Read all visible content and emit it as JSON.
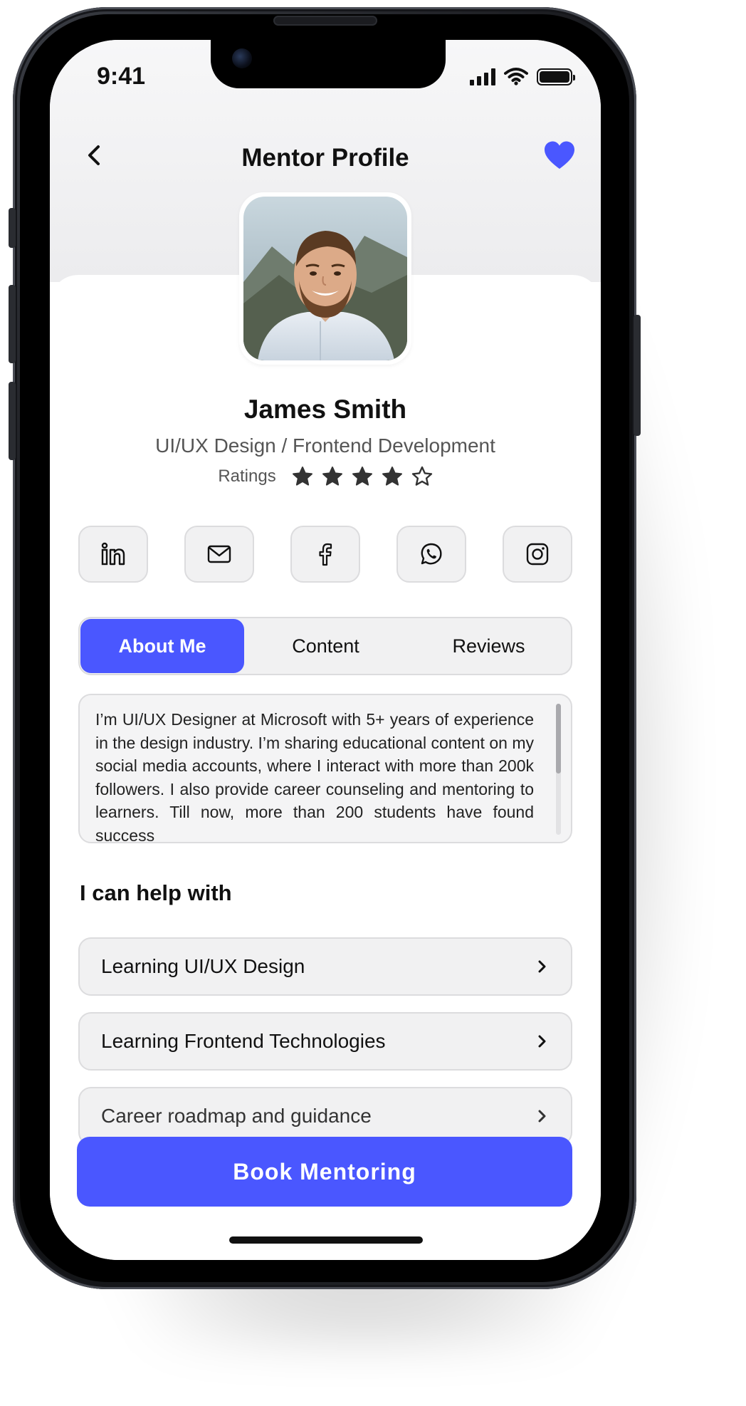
{
  "status_bar": {
    "time": "9:41"
  },
  "nav": {
    "title": "Mentor Profile"
  },
  "profile": {
    "name": "James Smith",
    "subtitle": "UI/UX Design / Frontend Development",
    "ratings_label": "Ratings",
    "rating": 4,
    "rating_max": 5
  },
  "socials": [
    "linkedin-icon",
    "mail-icon",
    "facebook-icon",
    "whatsapp-icon",
    "instagram-icon"
  ],
  "tabs": [
    {
      "label": "About Me",
      "active": true
    },
    {
      "label": "Content",
      "active": false
    },
    {
      "label": "Reviews",
      "active": false
    }
  ],
  "about": {
    "text": "I’m UI/UX Designer at Microsoft with 5+ years of experience in the design industry. I’m sharing educational content on my social media accounts, where I interact with more than 200k followers. I also provide career counseling and mentoring to learners. Till now, more than 200 students have found success"
  },
  "help": {
    "title": "I can help with",
    "items": [
      {
        "label": "Learning UI/UX Design"
      },
      {
        "label": "Learning Frontend Technologies"
      },
      {
        "label": "Career roadmap and guidance"
      }
    ]
  },
  "cta": {
    "label": "Book Mentoring"
  },
  "colors": {
    "accent": "#4a57ff",
    "star": "#333333"
  }
}
